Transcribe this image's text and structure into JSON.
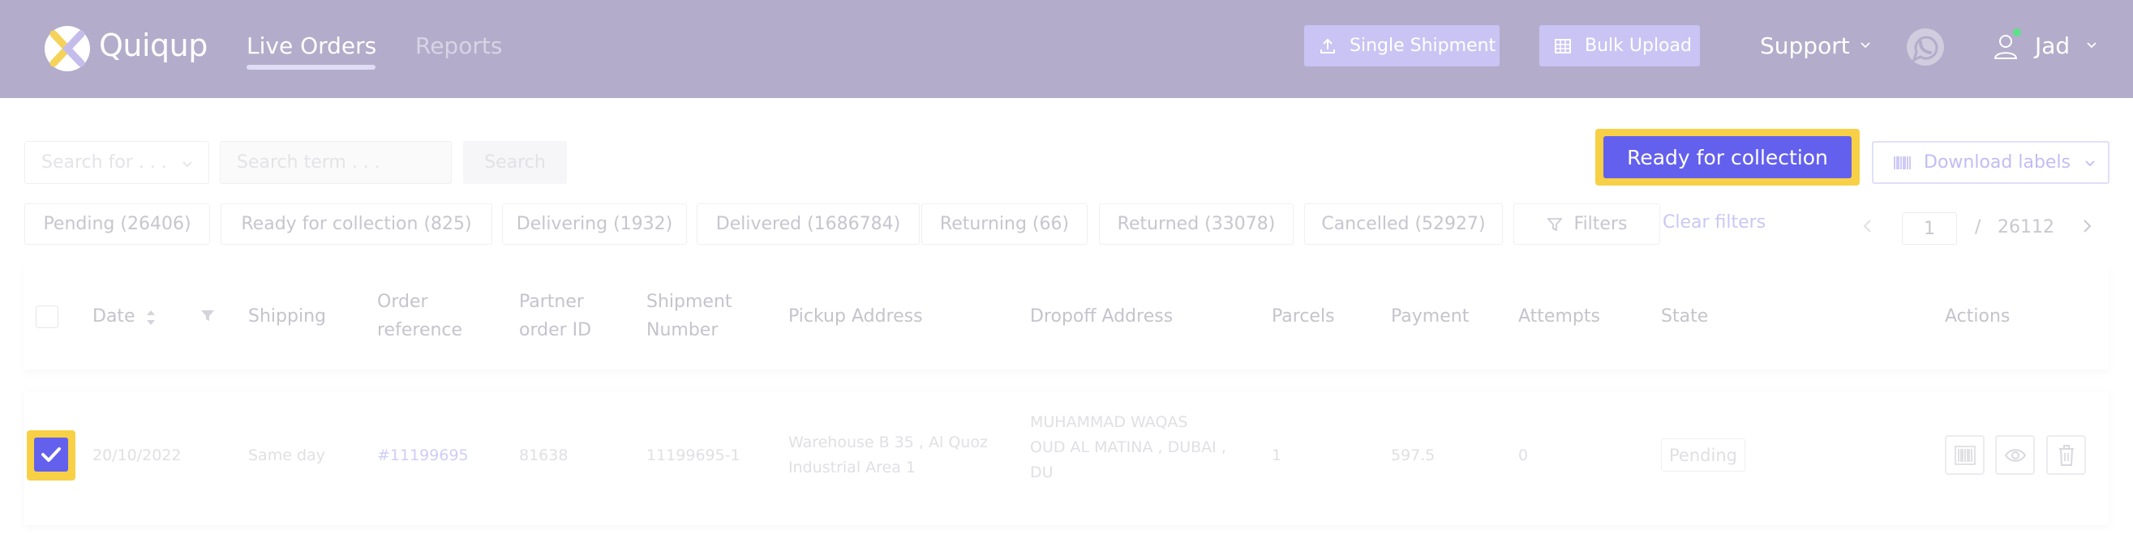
{
  "header": {
    "brand": "Quiqup",
    "nav": {
      "live_orders": "Live Orders",
      "reports": "Reports"
    },
    "single_shipment": "Single Shipment",
    "bulk_upload": "Bulk Upload",
    "support": "Support",
    "user_name": "Jad"
  },
  "toolbar": {
    "search_for_placeholder": "Search for . . .",
    "search_term_placeholder": "Search term . . .",
    "search_label": "Search",
    "ready_for_collection": "Ready for collection",
    "download_labels": "Download labels"
  },
  "filters": {
    "chips": [
      "Pending (26406)",
      "Ready for collection (825)",
      "Delivering (1932)",
      "Delivered (1686784)",
      "Returning (66)",
      "Returned (33078)",
      "Cancelled (52927)"
    ],
    "filters_label": "Filters",
    "clear_filters": "Clear filters"
  },
  "pagination": {
    "current": "1",
    "separator": "/",
    "total": "26112"
  },
  "table": {
    "columns": {
      "date": "Date",
      "shipping": "Shipping",
      "order_ref_1": "Order",
      "order_ref_2": "reference",
      "partner_1": "Partner",
      "partner_2": "order ID",
      "shipment_1": "Shipment",
      "shipment_2": "Number",
      "pickup": "Pickup Address",
      "dropoff": "Dropoff Address",
      "parcels": "Parcels",
      "payment": "Payment",
      "attempts": "Attempts",
      "state": "State",
      "actions": "Actions"
    },
    "rows": [
      {
        "selected": true,
        "date": "20/10/2022",
        "shipping": "Same day",
        "order_reference": "#11199695",
        "partner_order_id": "81638",
        "shipment_number": "11199695-1",
        "pickup_line1": "Warehouse B 35 , Al Quoz",
        "pickup_line2": "Industrial Area 1",
        "dropoff_line1": "MUHAMMAD WAQAS",
        "dropoff_line2": "OUD AL MATINA , DUBAI ,",
        "dropoff_line3": "DU",
        "parcels": "1",
        "payment": "597.5",
        "attempts": "0",
        "state": "Pending"
      }
    ]
  },
  "colors": {
    "header_bg": "#b3acca",
    "accent": "#6360ee",
    "highlight": "#f7d046"
  }
}
